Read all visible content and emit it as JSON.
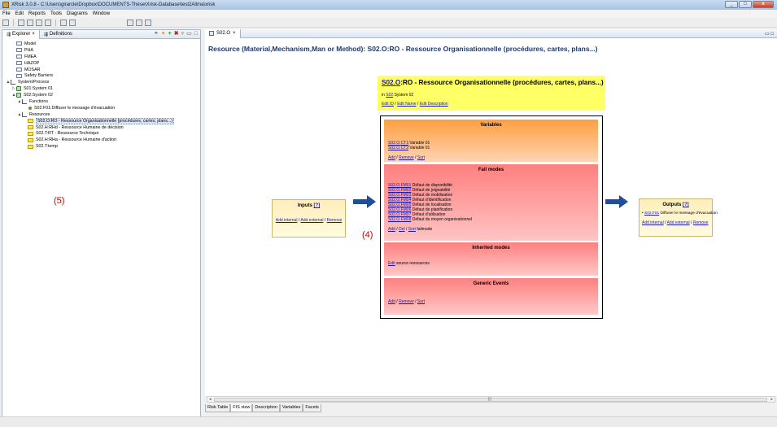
{
  "window": {
    "title": "XRisk 3.0.8 - C:\\Users\\girarcle\\Dropbox\\DOCUMENTS-Thèse\\Xrisk-Database\\test2Allma\\xrisk",
    "controls": [
      "_",
      "□",
      "x"
    ]
  },
  "menu": [
    "File",
    "Edit",
    "Reports",
    "Tools",
    "Diagrams",
    "Window"
  ],
  "explorer": {
    "tabs": [
      "Explorer",
      "Definitions"
    ],
    "tree": [
      {
        "label": "Model",
        "level": 1,
        "icon": "table-icon"
      },
      {
        "label": "PHA",
        "level": 1,
        "icon": "table-icon"
      },
      {
        "label": "FMEA",
        "level": 1,
        "icon": "table-icon"
      },
      {
        "label": "HAZOP",
        "level": 1,
        "icon": "table-icon"
      },
      {
        "label": "MOSAR",
        "level": 1,
        "icon": "table-icon"
      },
      {
        "label": "Safety Barriers",
        "level": 1,
        "icon": "table-icon"
      },
      {
        "label": "System/Process",
        "level": 0,
        "icon": "function-icon",
        "expand": "▲"
      },
      {
        "label": "S01:System 01",
        "level": 1,
        "icon": "system-icon",
        "expand": "▷"
      },
      {
        "label": "S02:System 02",
        "level": 1,
        "icon": "system-icon",
        "expand": "▲"
      },
      {
        "label": "Functions",
        "level": 2,
        "icon": "function-icon",
        "expand": "▲"
      },
      {
        "label": "S02.F01:Diffuser le message d'évacuation",
        "level": 3,
        "icon": "dot-icon"
      },
      {
        "label": "Resources",
        "level": 2,
        "icon": "function-icon",
        "expand": "▲"
      },
      {
        "label": "S02.O:RO - Ressource Organisationnelle (procédures, cartes, plans...)",
        "level": 3,
        "icon": "resource-icon",
        "selected": true
      },
      {
        "label": "S02.H:RHd - Ressource Humaine de décision",
        "level": 3,
        "icon": "resource-icon"
      },
      {
        "label": "S02.T:RT - Ressource Technique",
        "level": 3,
        "icon": "resource-icon"
      },
      {
        "label": "S02.H:RHa - Ressource Humaine d'action",
        "level": 3,
        "icon": "resource-icon"
      },
      {
        "label": "S02.T:temp",
        "level": 3,
        "icon": "resource-icon"
      }
    ]
  },
  "editor": {
    "tab": "S02.O",
    "heading": "Resource (Material,Mechanism,Man or Method): S02.O:RO - Ressource Organisationnelle (procédures, cartes, plans...)"
  },
  "header": {
    "id_link": "S02.O",
    "title_rest": ":RO - Ressource Organisationnelle (procédures, cartes, plans...)",
    "in_prefix": "in ",
    "in_link": "S02",
    "in_rest": ":System 02",
    "edit_id": "Edit ID",
    "edit_name": "Edit Name",
    "edit_description": "Edit Description",
    "sep": " / "
  },
  "variables": {
    "title": "Variables",
    "items": [
      {
        "code": "S02.O.CT1",
        "text": "Variable 01"
      },
      {
        "code": "S02.O.CT2",
        "text": "Variable 01"
      }
    ],
    "add": "Add",
    "remove": "Remove",
    "sort": "Sort"
  },
  "fail_modes": {
    "title": "Fail modes",
    "items": [
      {
        "code": "S02.O.FM01",
        "text": "Défaut de disponibilité"
      },
      {
        "code": "S02.O.FM02",
        "text": "Défaut de joignabilité"
      },
      {
        "code": "S02.O.FM03",
        "text": "Défaut de mobilisation"
      },
      {
        "code": "S02.O.FM04",
        "text": "Défaut d'identification"
      },
      {
        "code": "S02.O.FM05",
        "text": "Défaut de localisation"
      },
      {
        "code": "S02.O.FM06",
        "text": "Défaut de planification"
      },
      {
        "code": "S02.O.FM07",
        "text": "Défaut d'utilisation"
      },
      {
        "code": "S02.O.FM08",
        "text": "Défaut du moyen organisationnel"
      }
    ],
    "add": "Add",
    "del": "Del",
    "sort": "Sort",
    "suffix": " failmode"
  },
  "inherited_modes": {
    "title": "Inherited modes",
    "edit": "Edit",
    "suffix": " source ressources"
  },
  "generic_events": {
    "title": "Generic Events",
    "add": "Add",
    "remove": "Remove",
    "sort": "Sort"
  },
  "inputs": {
    "title": "Inputs",
    "help": "[?]",
    "add_internal": "Add internal",
    "add_external": "Add external",
    "remove": "Remove"
  },
  "outputs": {
    "title": "Outputs",
    "help": "[?]",
    "item_code": "S02.F01",
    "item_text": "Diffuser le message d'évacuation",
    "add_internal": "Add internal",
    "add_external": "Add external",
    "remove": "Remove"
  },
  "annotations": {
    "a4": "(4)",
    "a5": "(5)"
  },
  "bottom_tabs": [
    "Risk Table",
    "FIS view",
    "Description",
    "Variables",
    "Facets"
  ],
  "colors": {
    "variables": "#ff9f3f",
    "fail_modes": "#ff7f7f",
    "header": "#ffff66",
    "arrow": "#1f4e9c",
    "annotation": "#c00000"
  }
}
